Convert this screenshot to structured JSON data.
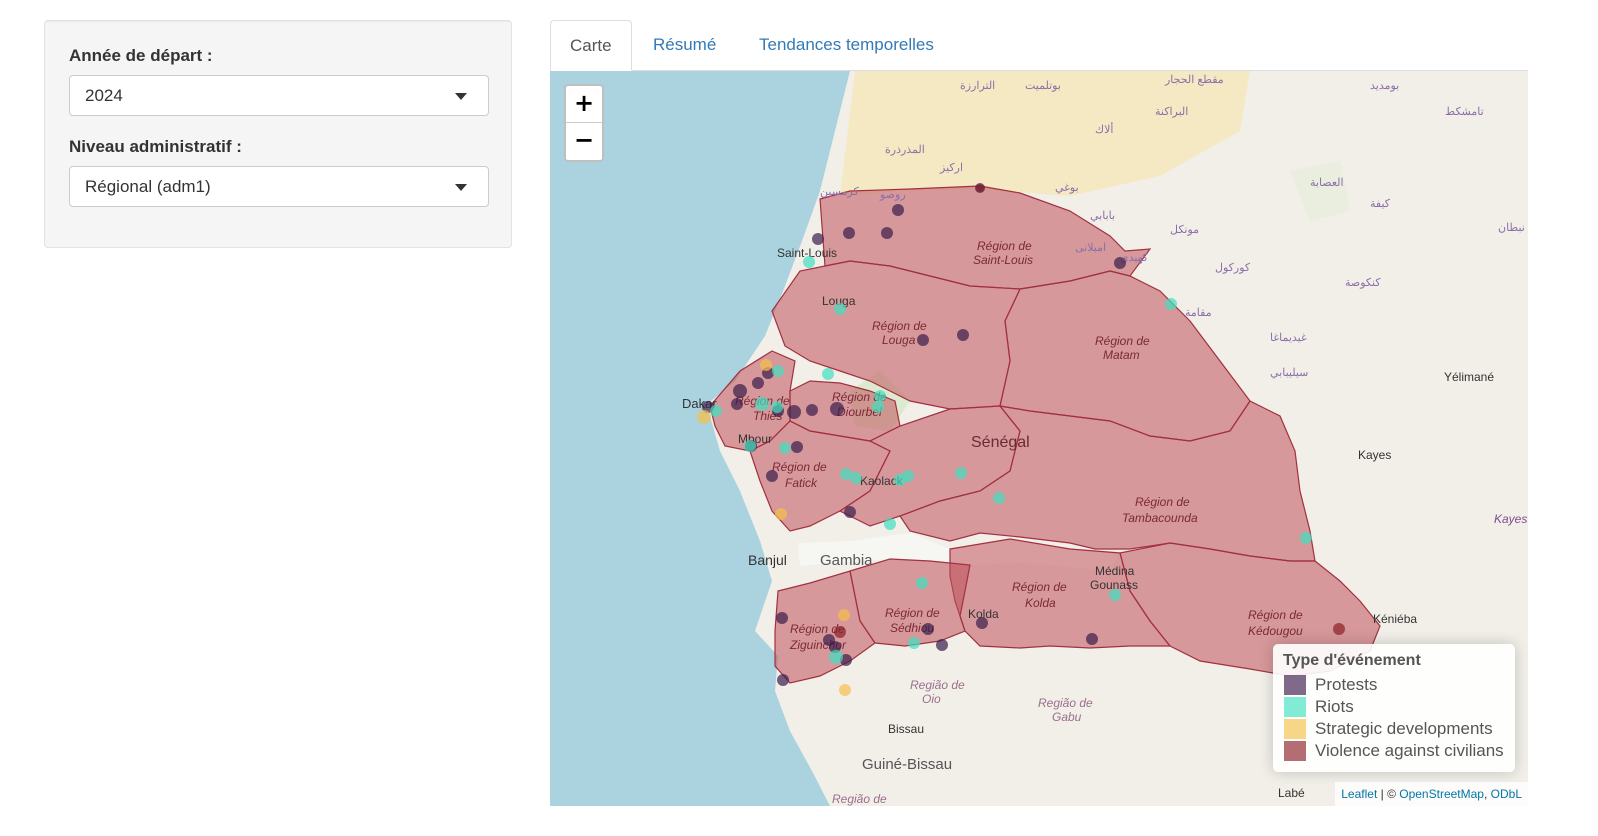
{
  "sidebar": {
    "year_label": "Année de départ :",
    "year_value": "2024",
    "level_label": "Niveau administratif :",
    "level_value": "Régional (adm1)"
  },
  "tabs": [
    {
      "label": "Carte",
      "active": true
    },
    {
      "label": "Résumé",
      "active": false
    },
    {
      "label": "Tendances temporelles",
      "active": false
    }
  ],
  "map": {
    "zoom_in": "+",
    "zoom_out": "−",
    "region_fill_color": "#c0505a",
    "country_label": "Sénégal",
    "region_labels": [
      [
        "Région de",
        "Saint-Louis"
      ],
      [
        "Région de",
        "Louga"
      ],
      [
        "Région de",
        "Matam"
      ],
      [
        "Région de",
        "Thiès"
      ],
      [
        "Région de",
        "Diourbel"
      ],
      [
        "Région de",
        "Fatick"
      ],
      [
        "Région de",
        "Tambacounda"
      ],
      [
        "Région de",
        "Kolda"
      ],
      [
        "Région de",
        "Sédhiou"
      ],
      [
        "Région de",
        "Ziguinchor"
      ],
      [
        "Région de",
        "Kédougou"
      ]
    ],
    "place_labels": [
      "Saint-Louis",
      "Louga",
      "Dakar",
      "Mbour",
      "Kaolack",
      "Banjul",
      "Gambia",
      "Kolda",
      "Médina Gounass",
      "Kayes",
      "Kéniéba",
      "Yélimané",
      "Bissau",
      "Guiné-Bissau",
      "Labé",
      "Região de Oio",
      "Região de Gabu",
      "Região de",
      "Kayes"
    ],
    "arabic_labels": [
      "الترارزة",
      "بوتلميت",
      "مقطع الحجار",
      "بومديد",
      "تامشكط",
      "البراكنة",
      "ألاك",
      "المذرذرة",
      "اركيز",
      "كرمسين",
      "روصو",
      "بوغي",
      "العصابة",
      "كيفة",
      "بابابي",
      "مونكل",
      "امبلانى",
      "كهيدي",
      "كوركول",
      "كنكوصة",
      "مقامة",
      "غيديماغا",
      "سيليبابي",
      "لعيون",
      "نبطان"
    ],
    "legend": {
      "title": "Type d'événement",
      "items": [
        {
          "label": "Protests",
          "color": "#3b1c4b"
        },
        {
          "label": "Riots",
          "color": "#3fe0c0"
        },
        {
          "label": "Strategic developments",
          "color": "#f5c04a"
        },
        {
          "label": "Violence against civilians",
          "color": "#8c1f28"
        }
      ]
    },
    "attribution": {
      "leaflet": "Leaflet",
      "sep": " | © ",
      "osm": "OpenStreetMap",
      "comma": ", ",
      "odbl": "ODbL"
    }
  }
}
